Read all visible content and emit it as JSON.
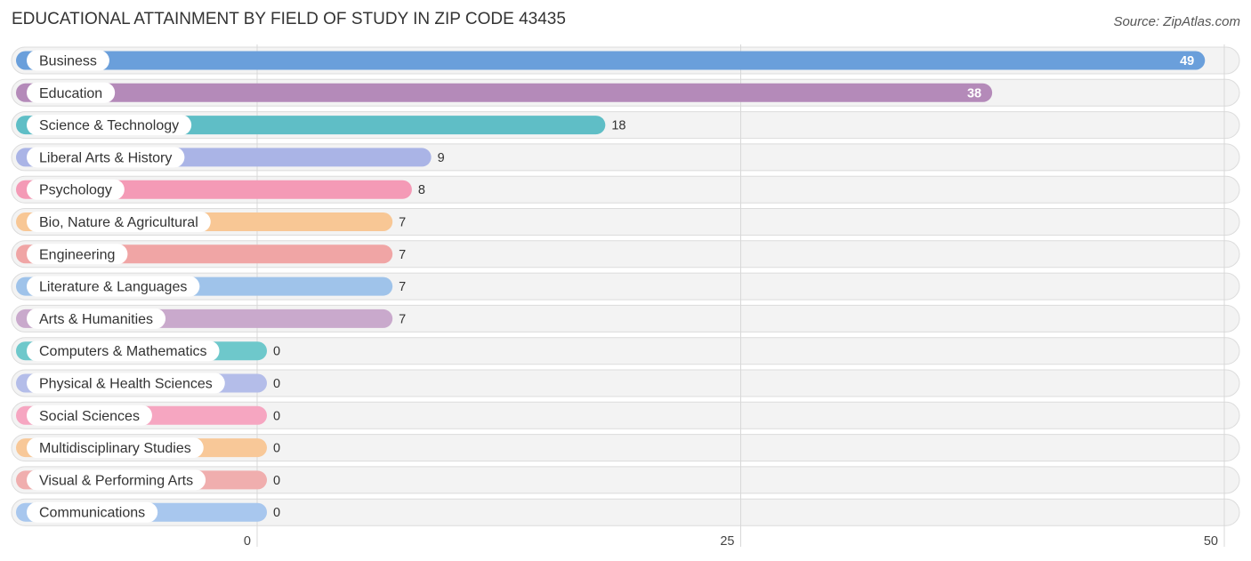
{
  "header": {
    "title": "EDUCATIONAL ATTAINMENT BY FIELD OF STUDY IN ZIP CODE 43435",
    "source": "Source: ZipAtlas.com"
  },
  "chart_data": {
    "type": "bar",
    "orientation": "horizontal",
    "title": "EDUCATIONAL ATTAINMENT BY FIELD OF STUDY IN ZIP CODE 43435",
    "xlabel": "",
    "ylabel": "",
    "xlim": [
      0,
      50
    ],
    "xticks": [
      0,
      25,
      50
    ],
    "grid": true,
    "categories": [
      "Business",
      "Education",
      "Science & Technology",
      "Liberal Arts & History",
      "Psychology",
      "Bio, Nature & Agricultural",
      "Engineering",
      "Literature & Languages",
      "Arts & Humanities",
      "Computers & Mathematics",
      "Physical & Health Sciences",
      "Social Sciences",
      "Multidisciplinary Studies",
      "Visual & Performing Arts",
      "Communications"
    ],
    "values": [
      49,
      38,
      18,
      9,
      8,
      7,
      7,
      7,
      7,
      0,
      0,
      0,
      0,
      0,
      0
    ],
    "colors": [
      "#6a9fdb",
      "#b48ab9",
      "#5fbec6",
      "#aab4e6",
      "#f49ab6",
      "#f8c795",
      "#f0a5a5",
      "#9fc3ea",
      "#c9a9cc",
      "#6ec8cb",
      "#b4bde9",
      "#f6a6c1",
      "#f8c898",
      "#f0aeae",
      "#a8c7ee"
    ]
  }
}
